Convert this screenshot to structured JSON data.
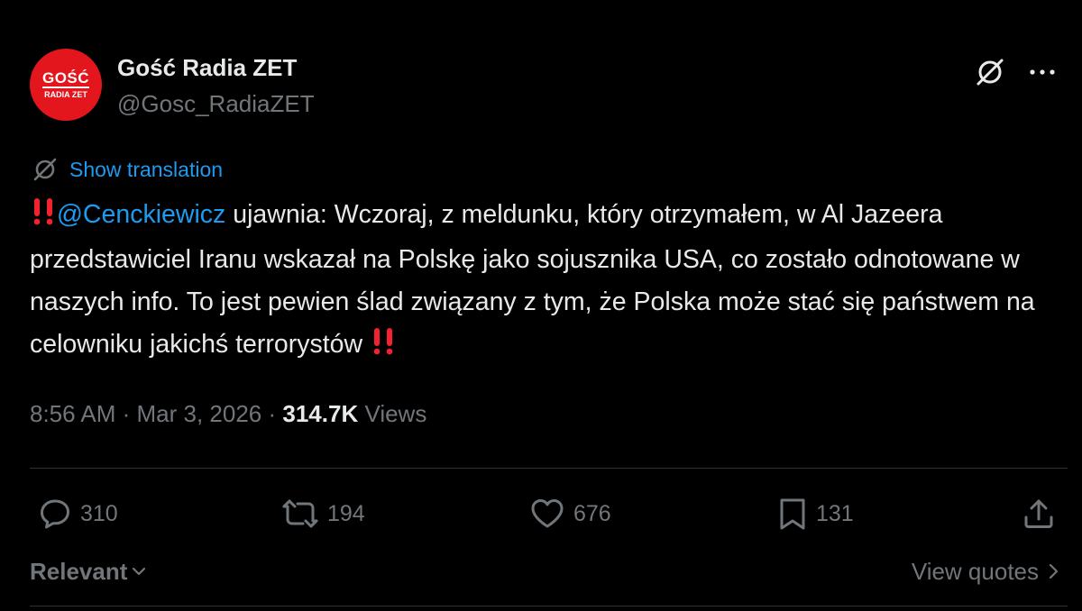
{
  "author": {
    "display_name": "Gość Radia ZET",
    "handle": "@Gosc_RadiaZET",
    "avatar_logo_top": "GOŚĆ",
    "avatar_logo_bottom": "RADIA ZET",
    "avatar_color": "#e3161d"
  },
  "header_icons": {
    "grok": "grok-icon",
    "more": "more-icon"
  },
  "translation": {
    "label": "Show translation",
    "icon": "translate-icon"
  },
  "tweet": {
    "mention": "@Cenckiewicz",
    "body": " ujawnia: Wczoraj, z meldunku, który otrzymałem, w Al Jazeera przedstawiciel Iranu wskazał na Polskę jako sojusznika USA, co zostało odnotowane w naszych info. To jest pewien ślad związany z tym, że Polska może stać się państwem na celowniku jakichś terrorystów ",
    "emoji": "double-exclamation-icon"
  },
  "meta": {
    "time": "8:56 AM",
    "separator": " · ",
    "date": "Mar 3, 2026",
    "views_count": "314.7K",
    "views_label": " Views"
  },
  "actions": {
    "replies": "310",
    "reposts": "194",
    "likes": "676",
    "bookmarks": "131"
  },
  "footer": {
    "sort_label": "Relevant",
    "view_quotes": "View quotes"
  },
  "colors": {
    "background": "#000000",
    "text": "#e7e9ea",
    "muted": "#71767b",
    "accent": "#1d9bf0",
    "divider": "#2f3336",
    "emoji_red": "#f4212e"
  }
}
